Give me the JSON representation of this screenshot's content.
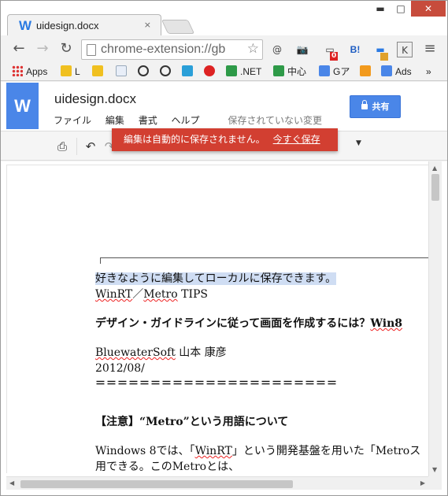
{
  "browser": {
    "tab_title": "uidesign.docx",
    "tab_favicon": "W",
    "tab_close": "×",
    "win_min": "▬",
    "win_max": "□",
    "win_close": "✕",
    "omnibox_text": "chrome-extension://gb",
    "extension_labels": [
      "@",
      "B!",
      "K"
    ],
    "badge_count": "0",
    "bookmarks": [
      {
        "label": "Apps",
        "icon": "apps-grid-icon"
      },
      {
        "label": "L",
        "icon": "mountain-icon"
      },
      {
        "label": "",
        "icon": "mountain-icon"
      },
      {
        "label": "",
        "icon": "page-icon"
      },
      {
        "label": "",
        "icon": "circle-i-icon"
      },
      {
        "label": "",
        "icon": "circle-i-icon"
      },
      {
        "label": "",
        "icon": "m-icon"
      },
      {
        "label": "",
        "icon": "red-circle-icon"
      },
      {
        "label": ".NET",
        "icon": "green-at-icon"
      },
      {
        "label": "中心",
        "icon": "green-at-icon"
      },
      {
        "label": "Gア",
        "icon": "g-icon"
      },
      {
        "label": "",
        "icon": "chart-icon"
      },
      {
        "label": "Ads",
        "icon": "g-icon"
      }
    ],
    "bookmarks_more": "»"
  },
  "docs": {
    "logo_letter": "W",
    "title": "uidesign.docx",
    "menus": [
      "ファイル",
      "編集",
      "書式",
      "ヘルプ"
    ],
    "save_status": "保存されていない変更",
    "share_label": "共有",
    "notification_text": "編集は自動的に保存されません。",
    "notification_link": "今すぐ保存"
  },
  "document": {
    "line1": "好きなように編集してローカルに保存できます。",
    "line2a": "WinRT",
    "line2b": "／",
    "line2c": "Metro",
    "line2d": " TIPS",
    "line3": "デザイン・ガイドラインに従って画面を作成するには？",
    "line3b": "Win8",
    "line4a": "BluewaterSoft",
    "line4b": " 山本 康彦",
    "line5": "2012/08/",
    "line6": "＝＝＝＝＝＝＝＝＝＝＝＝＝＝＝＝＝＝＝＝＝＝",
    "line7": "【注意】“Metro”という用語について",
    "line8a": " Windows 8では、「",
    "line8b": "WinRT",
    "line8c": "」という開発基盤を用いた「Metroス",
    "line9": "用できる。このMetroとは、"
  }
}
